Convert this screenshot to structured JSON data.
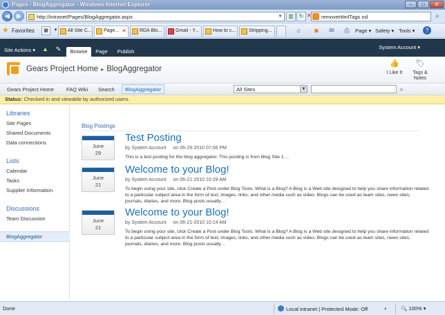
{
  "window": {
    "title": "Pages - BlogAggregator - Windows Internet Explorer",
    "minimize": "–",
    "maximize": "□",
    "close": "✕"
  },
  "address": {
    "url": "http://intranet/Pages/BlogAggregator.aspx",
    "search_value": "removeHtmlTags xsl"
  },
  "tabbar": {
    "favorites_label": "Favorites",
    "tabs": [
      {
        "label": "All Site C..."
      },
      {
        "label": "Page..."
      },
      {
        "label": "RDA Blo..."
      },
      {
        "label": "Gmail - Y..."
      },
      {
        "label": "How to c..."
      },
      {
        "label": "Stripping..."
      }
    ],
    "commands": {
      "page": "Page ▾",
      "safety": "Safety ▾",
      "tools": "Tools ▾",
      "help": "?"
    }
  },
  "ribbon": {
    "site_actions": "Site Actions ▾",
    "tabs": [
      {
        "label": "Browse"
      },
      {
        "label": "Page"
      },
      {
        "label": "Publish"
      }
    ],
    "account": "System Account ▾"
  },
  "site": {
    "home": "Gears Project Home",
    "separator": "▸",
    "current": "BlogAggregator",
    "i_like_it": "I Like It",
    "tags_notes": "Tags &\nNotes"
  },
  "topnav": {
    "items": [
      {
        "label": "Gears Project Home"
      },
      {
        "label": "FAQ Wiki"
      },
      {
        "label": "Search"
      },
      {
        "label": "BlogAggregator"
      }
    ],
    "scope": "All Sites"
  },
  "status": {
    "label": "Status:",
    "text": "Checked in and viewable by authorized users."
  },
  "leftnav": {
    "libraries": {
      "heading": "Libraries",
      "items": [
        "Site Pages",
        "Shared Documents",
        "Data connections"
      ]
    },
    "lists": {
      "heading": "Lists",
      "items": [
        "Calendar",
        "Tasks",
        "Supplier Information"
      ]
    },
    "discussions": {
      "heading": "Discussions",
      "items": [
        "Team Discussion"
      ]
    },
    "selected": "BlogAggregator"
  },
  "main": {
    "heading": "Blog Postings",
    "posts": [
      {
        "month": "June",
        "day": "29",
        "title": "Test Posting",
        "by": "by System Account",
        "on": "on 06-29-2010 07:06 PM",
        "body": "This is a test posting for the blog aggregator. This posting is from Blog Site 1",
        "more": "...."
      },
      {
        "month": "June",
        "day": "21",
        "title": "Welcome to your Blog!",
        "by": "by System Account",
        "on": "on 06-21-2010 10:28 AM",
        "body": "To begin using your site, click Create a Post under Blog Tools. What is a Blog? A Blog is a Web site designed to help you share information related to a particular subject area in the form of text, images, links, and other media such as video. Blogs can be used as team sites, news sites, journals, diaries, and more. Blog posts usually",
        "more": "...."
      },
      {
        "month": "June",
        "day": "21",
        "title": "Welcome to your Blog!",
        "by": "by System Account",
        "on": "on 06-21-2010 10:14 AM",
        "body": "To begin using your site, click Create a Post under Blog Tools. What is a Blog? A Blog is a Web site designed to help you share information related to a particular subject area in the form of text, images, links, and other media such as video. Blogs can be used as team sites, news sites, journals, diaries, and more. Blog posts usually",
        "more": "...."
      }
    ]
  },
  "statusbar": {
    "done": "Done",
    "zone": "Local intranet | Protected Mode: Off",
    "zoom": "100%"
  }
}
